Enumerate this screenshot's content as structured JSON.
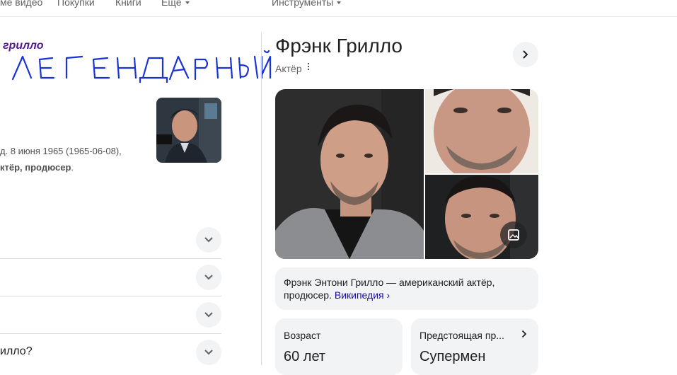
{
  "top_nav": {
    "items": [
      "ме видео",
      "Покупки",
      "Книги",
      "Еще"
    ],
    "tools": "Инструменты"
  },
  "left": {
    "result_title": "грилло",
    "handwritten_note": "ЛЕГЕНДАРНЫЙ",
    "bio_line1": "д. 8 июня 1965 (1965-06-08),",
    "bio_line2_bold": "ктёр, продюсер",
    "bio_line2_end": ".",
    "accordion_question_partial": "илло?"
  },
  "panel": {
    "name": "Фрэнк Грилло",
    "subtitle": "Актёр",
    "description": "Фрэнк Энтони Грилло — американский актёр, продюсер.",
    "source_link": "Википедия",
    "facts": [
      {
        "label": "Возраст",
        "value": "60 лет"
      },
      {
        "label": "Предстоящая пр...",
        "value": "Супермен"
      }
    ]
  },
  "colors": {
    "accent_link": "#1a0dab",
    "visited_title": "#52188c",
    "handwriting": "#1a33d6",
    "card_bg": "#f1f3f4"
  },
  "icons": [
    "chevron-down-icon",
    "chevron-right-icon",
    "more-vert-icon",
    "image-search-icon"
  ]
}
